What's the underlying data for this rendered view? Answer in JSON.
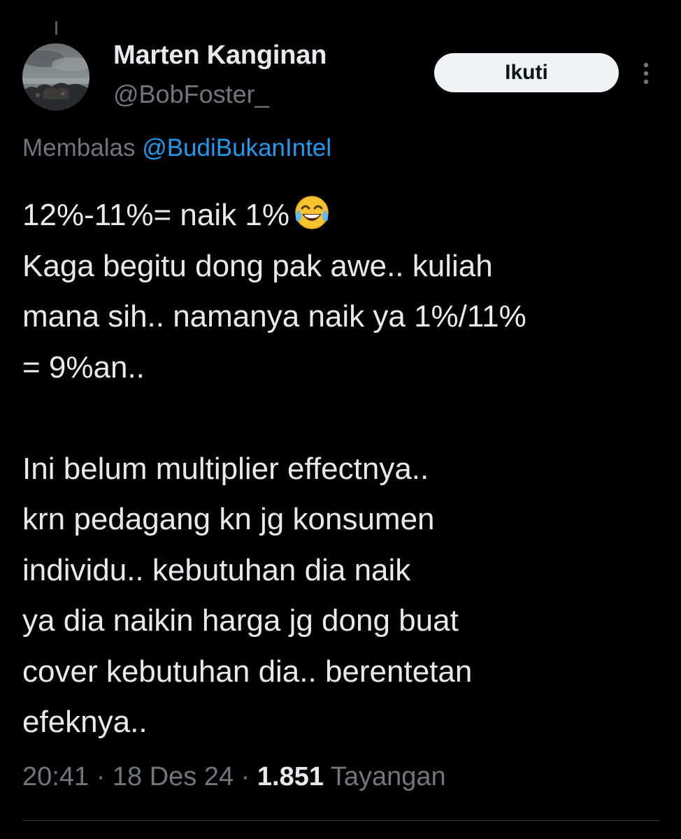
{
  "author": {
    "name": "Marten Kanginan",
    "handle": "@BobFoster_",
    "avatar": "avatar-photo"
  },
  "actions": {
    "follow_label": "Ikuti",
    "more_icon": "more-vertical-icon"
  },
  "reply": {
    "prefix": "Membalas",
    "mention": "@BudiBukanIntel"
  },
  "tweet": {
    "lines": [
      "12%-11%= naik 1%",
      "Kaga begitu dong pak awe.. kuliah",
      "mana sih.. namanya naik ya 1%/11%",
      "= 9%an..",
      "",
      "Ini belum multiplier effectnya..",
      "krn pedagang kn jg konsumen",
      "individu.. kebutuhan dia naik",
      "ya dia naikin harga jg dong buat",
      "cover kebutuhan dia.. berentetan",
      "efeknya.."
    ],
    "emoji": "face-with-tears-of-joy-emoji"
  },
  "meta": {
    "time": "20:41",
    "separator": "·",
    "date": "18 Des 24",
    "views_count": "1.851",
    "views_label": "Tayangan"
  },
  "colors": {
    "background": "#000000",
    "text": "#e7e9ea",
    "secondary": "#71767b",
    "link": "#1d9bf0",
    "button_bg": "#eff3f4"
  }
}
